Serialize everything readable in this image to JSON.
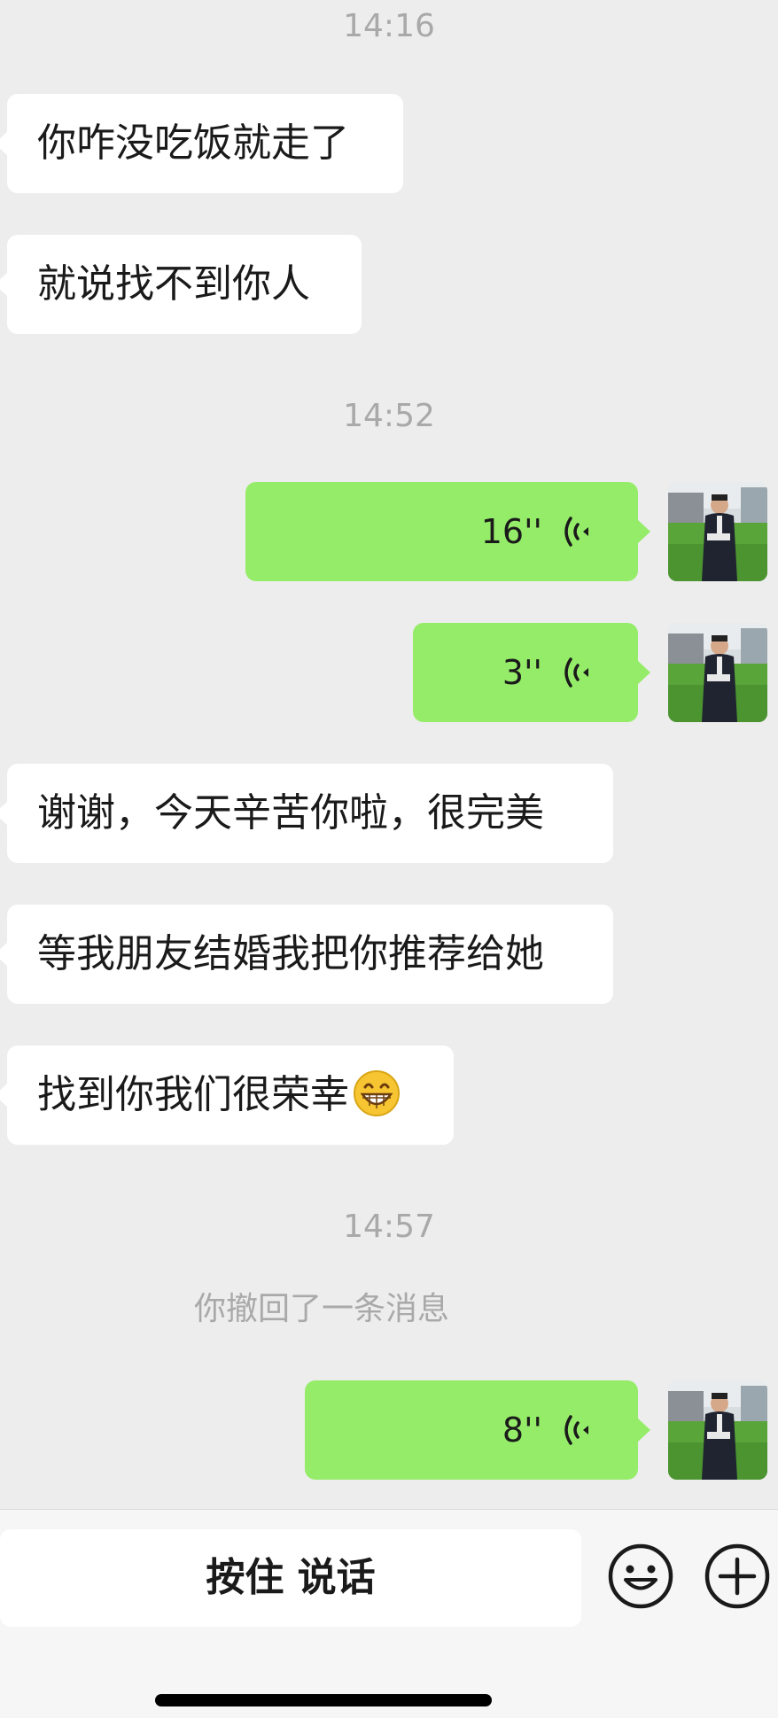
{
  "messages": [
    {
      "type": "time",
      "text": "14:16"
    },
    {
      "type": "text",
      "side": "in",
      "text": "你咋没吃饭就走了"
    },
    {
      "type": "text",
      "side": "in",
      "text": "就说找不到你人"
    },
    {
      "type": "time",
      "text": "14:52"
    },
    {
      "type": "voice",
      "side": "out",
      "duration": "16''"
    },
    {
      "type": "voice",
      "side": "out",
      "duration": "3''"
    },
    {
      "type": "text",
      "side": "in",
      "text": "谢谢，今天辛苦你啦，很完美"
    },
    {
      "type": "text",
      "side": "in",
      "text": "等我朋友结婚我把你推荐给她"
    },
    {
      "type": "text",
      "side": "in",
      "text": "找到你我们很荣幸",
      "emoji": "grinning-face"
    },
    {
      "type": "time",
      "text": "14:57"
    },
    {
      "type": "system",
      "text": "你撤回了一条消息"
    },
    {
      "type": "voice",
      "side": "out",
      "duration": "8''"
    }
  ],
  "input_bar": {
    "hold_to_talk_label": "按住 说话",
    "icons": [
      "emoji-icon",
      "plus-icon"
    ]
  },
  "colors": {
    "background": "#ededed",
    "incoming_bubble": "#ffffff",
    "outgoing_bubble": "#95ec69",
    "timestamp": "#a9a9a9",
    "toolbar": "#f6f6f6"
  }
}
